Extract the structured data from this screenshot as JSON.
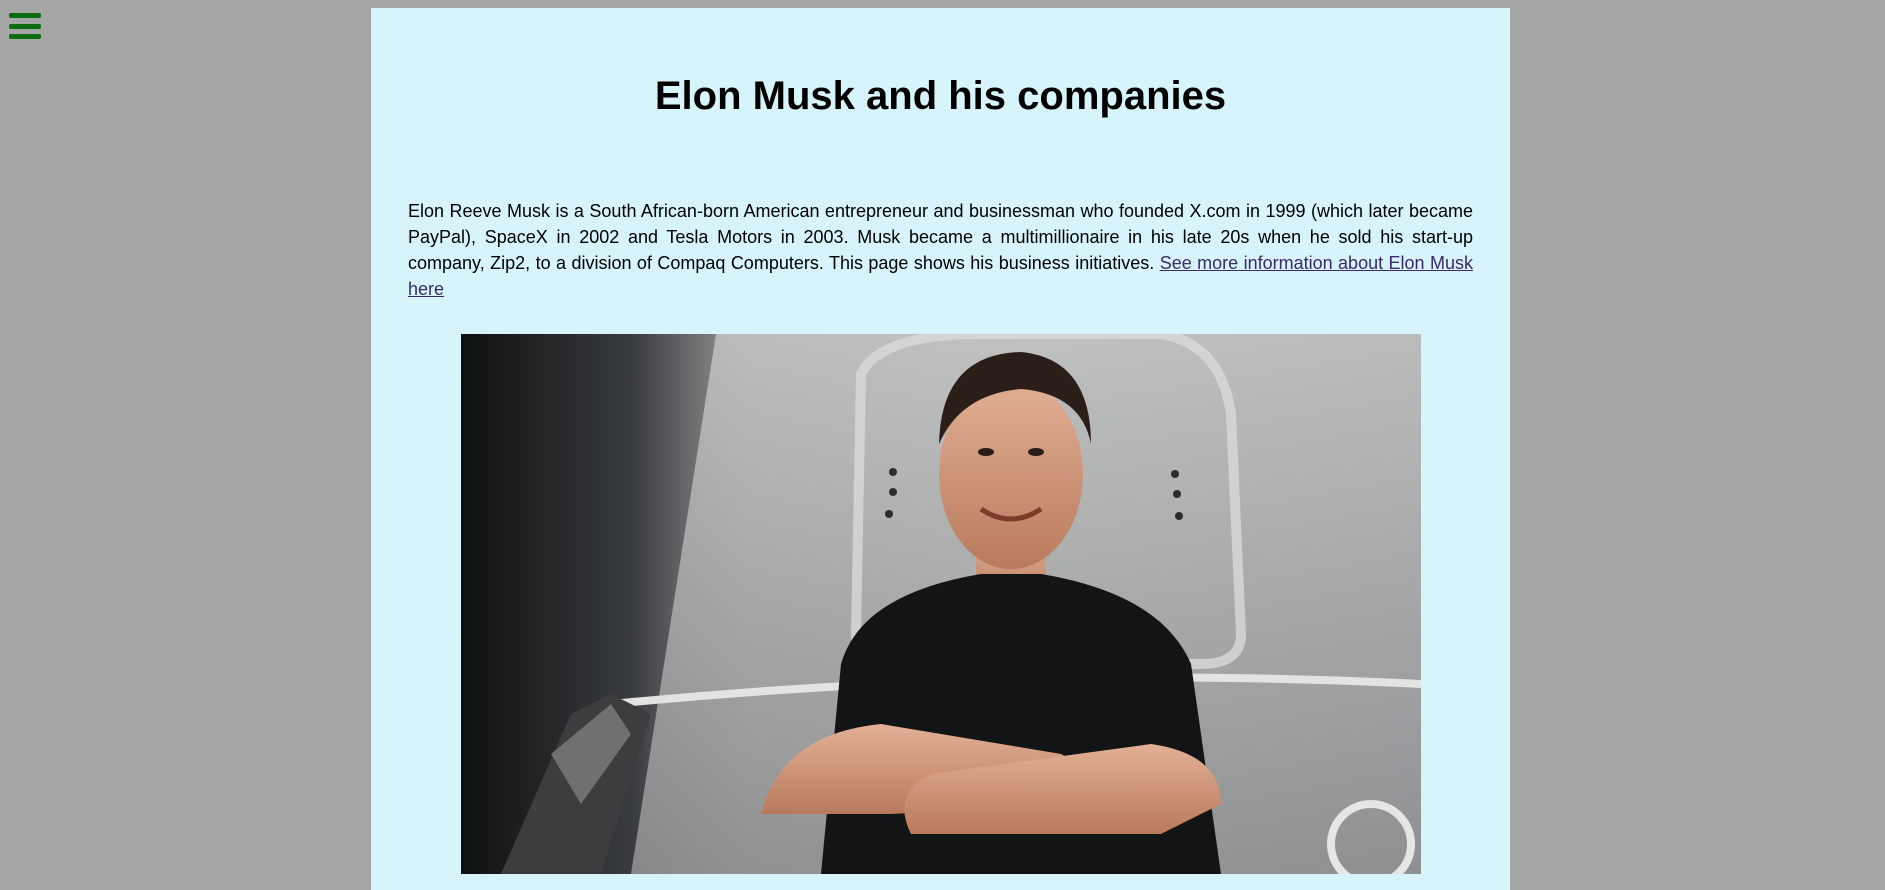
{
  "menu": {
    "icon": "hamburger-menu-icon",
    "color": "#0b6b10"
  },
  "page": {
    "background": "#d6f4f9",
    "title": "Elon Musk and his companies",
    "intro_text": "Elon Reeve Musk is a South African-born American entrepreneur and businessman who founded X.com in 1999 (which later became PayPal), SpaceX in 2002 and Tesla Motors in 2003. Musk became a multimillionaire in his late 20s when he sold his start-up company, Zip2, to a division of Compaq Computers. This page shows his business initiatives.",
    "intro_link": "See more information about Elon Musk here",
    "image_subject": "Elon Musk portrait in black t-shirt with arms crossed in front of a spacecraft capsule"
  }
}
